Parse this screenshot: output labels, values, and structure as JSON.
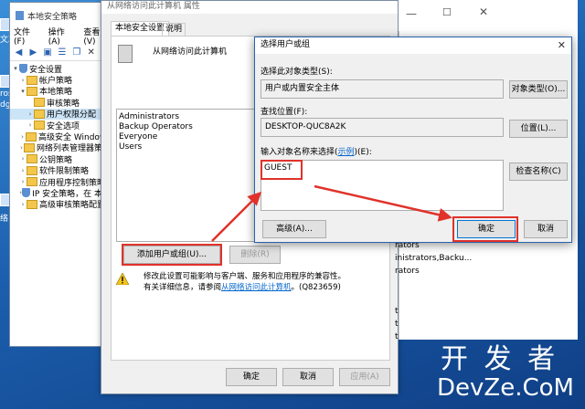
{
  "policy_window": {
    "title": "本地安全策略",
    "menu": [
      "文件(F)",
      "操作(A)",
      "查看(V)"
    ],
    "tree": [
      {
        "label": "安全设置",
        "level": 0
      },
      {
        "label": "帐户策略",
        "level": 1
      },
      {
        "label": "本地策略",
        "level": 1
      },
      {
        "label": "审核策略",
        "level": 2
      },
      {
        "label": "用户权限分配",
        "level": 2,
        "selected": true
      },
      {
        "label": "安全选项",
        "level": 2
      },
      {
        "label": "高级安全 Windows",
        "level": 1
      },
      {
        "label": "网络列表管理器策略",
        "level": 1
      },
      {
        "label": "公钥策略",
        "level": 1
      },
      {
        "label": "软件限制策略",
        "level": 1
      },
      {
        "label": "应用程序控制策略",
        "level": 1
      },
      {
        "label": "IP 安全策略，在 本地",
        "level": 1
      },
      {
        "label": "高级审核策略配置",
        "level": 1
      }
    ]
  },
  "desktop_labels": [
    "文次",
    "ros",
    "dge",
    "络"
  ],
  "properties_window": {
    "title": "从网络访问此计算机 属性",
    "tabs": [
      "本地安全设置",
      "说明"
    ],
    "policy_name": "从网络访问此计算机",
    "members": [
      "Administrators",
      "Backup Operators",
      "Everyone",
      "Users"
    ],
    "add_button": "添加用户或组(U)...",
    "remove_button": "删除(R)",
    "warning_line1": "修改此设置可能影响与客户端、服务和应用程序的兼容性。",
    "warning_line2_prefix": "有关详细信息，请参阅",
    "warning_link": "从网络访问此计算机",
    "warning_line2_suffix": "。(Q823659)",
    "ok": "确定",
    "cancel": "取消",
    "apply": "应用(A)"
  },
  "behind_list": [
    "rators",
    "inistrators,Backu...",
    "rators",
    "t",
    "t",
    "t"
  ],
  "dialog": {
    "title": "选择用户或组",
    "object_type_label": "选择此对象类型(S):",
    "object_type_value": "用户或内置安全主体",
    "object_type_button": "对象类型(O)...",
    "location_label": "查找位置(F):",
    "location_value": "DESKTOP-QUC8A2K",
    "location_button": "位置(L)...",
    "names_label_prefix": "输入对象名称来选择(",
    "names_label_link": "示例",
    "names_label_suffix": ")(E):",
    "names_value": "GUEST",
    "check_names_button": "检查名称(C)",
    "advanced_button": "高级(A)...",
    "ok": "确定",
    "cancel": "取消"
  },
  "watermark": {
    "line1": "开 发 者",
    "line2": "DevZe.CoM"
  },
  "colors": {
    "accent": "#2a62b0",
    "highlight": "#e0322b",
    "selection": "#cce4f7"
  }
}
